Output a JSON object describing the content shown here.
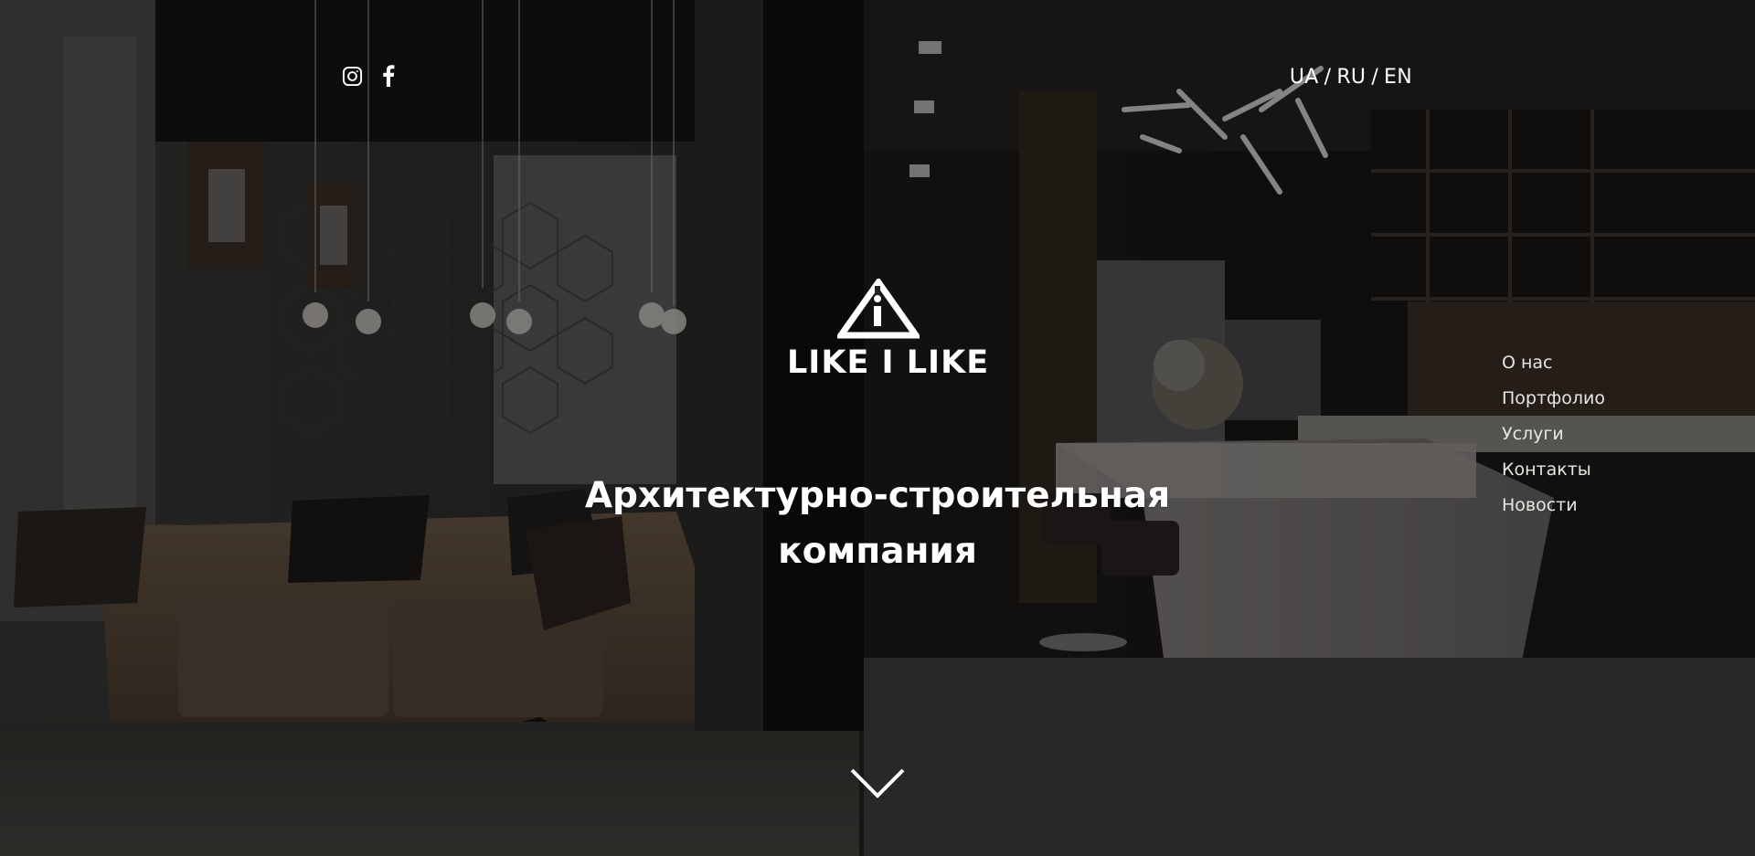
{
  "social": {
    "instagram_icon": "instagram-icon",
    "facebook_icon": "facebook-icon"
  },
  "languages": {
    "items": [
      "UA",
      "RU",
      "EN"
    ],
    "separator": "/"
  },
  "logo": {
    "text": "LIKE I LIKE"
  },
  "hero": {
    "headline_line1": "Архитектурно-строительная",
    "headline_line2": "компания"
  },
  "menu": {
    "items": [
      "О нас",
      "Портфолио",
      "Услуги",
      "Контакты",
      "Новости"
    ]
  },
  "scroll": {
    "icon": "chevron-down-icon"
  },
  "colors": {
    "text": "#ffffff",
    "menu_text": "#e8e6e3",
    "overlay": "#1a1816"
  }
}
